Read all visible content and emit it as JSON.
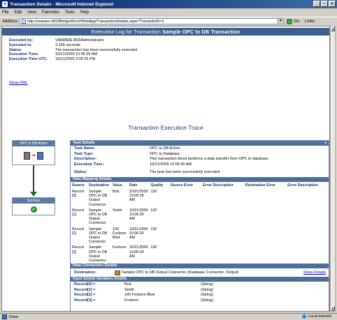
{
  "window": {
    "title": "Transaction Details - Microsoft Internet Explorer",
    "min": "_",
    "restore": "▫",
    "close": "×"
  },
  "menu": [
    "File",
    "Edit",
    "View",
    "Favorites",
    "Tools",
    "Help"
  ],
  "address": {
    "label": "Address",
    "url": "http://vmware-802/BridgeWorX/WebApp/TransactionDetails.aspx?TransInfoID=1",
    "go_label": "Go",
    "links_label": "Links"
  },
  "header": {
    "prefix": "Execution Log for Transaction",
    "name": "Sample OPC to DB Transaction"
  },
  "info": [
    {
      "label": "Executed by:",
      "value": "VMWARE-802\\Administrator"
    },
    {
      "label": "Executed in:",
      "value": "3.155 seconds"
    },
    {
      "label": "Status:",
      "value": "The transaction has been successfully executed"
    },
    {
      "label": "Execution Time:",
      "value": "10/21/2005 10:06:25 AM"
    },
    {
      "label": "Execution Time UTC:",
      "value": "10/21/2005 2:06:25 PM"
    }
  ],
  "show_xml": "Show XML",
  "trace_title": "Transaction Execution Trace",
  "flow": {
    "step1": "OPC to DB Action",
    "step2": "Success"
  },
  "task_details": {
    "title": "Task Details",
    "close": "x",
    "rows": [
      {
        "label": "Task Name:",
        "value": "OPC to DB Action"
      },
      {
        "label": "Task Type:",
        "value": "OPC to Database"
      },
      {
        "label": "Description:",
        "value": "This transaction block performs a data transfer from OPC to database"
      },
      {
        "label": "Execution Time:",
        "value": "10/21/2005 10:06:30 AM"
      },
      {
        "label": "Status:",
        "value": "The task has been successfully executed"
      }
    ]
  },
  "data_mapping": {
    "title": "Data Mapping Details",
    "columns": [
      "Source",
      "Destination",
      "Value",
      "Date",
      "Quality",
      "Source Error",
      "Error Description",
      "Destination Error",
      "Error Description"
    ],
    "rows": [
      {
        "source": "Record [0]",
        "destination": "Sample OPC to DB Output Connector",
        "value": "Bob",
        "date": "10/21/2005 10:06:29 AM",
        "quality": "192"
      },
      {
        "source": "Record [1]",
        "destination": "Sample OPC to DB Output Connector",
        "value": "Smith",
        "date": "10/21/2005 10:06:29 AM",
        "quality": "192"
      },
      {
        "source": "Record [2]",
        "destination": "Sample OPC to DB Output Connector",
        "value": "100 Foxboro Blvd",
        "date": "10/21/2005 10:06:29 AM",
        "quality": "192"
      },
      {
        "source": "Record [3]",
        "destination": "Sample OPC to DB Output Connector",
        "value": "Foxboro",
        "date": "10/21/2005 10:06:29 AM",
        "quality": "192"
      }
    ]
  },
  "connectors": {
    "title": "Data Connectors Details",
    "label": "Destination:",
    "value": "Sample OPC to DB Output Connector (Database Connector, Output)",
    "show_details": "Show Details"
  },
  "globals": {
    "title": "Input Global Variables Details",
    "rows": [
      {
        "name": "Record[0] =",
        "value": "Bob",
        "type": "(String)"
      },
      {
        "name": "Record[1] =",
        "value": "Smith",
        "type": "(String)"
      },
      {
        "name": "Record[2] =",
        "value": "100 Foxboro Blvd",
        "type": "(String)"
      },
      {
        "name": "Record[3] =",
        "value": "Foxboro",
        "type": "(String)"
      }
    ]
  },
  "status": {
    "text": "Done",
    "zone": "Local intranet"
  }
}
